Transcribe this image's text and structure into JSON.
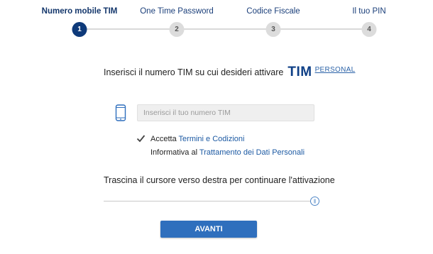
{
  "stepper": {
    "steps": [
      {
        "number": "1",
        "label": "Numero mobile TIM",
        "active": true
      },
      {
        "number": "2",
        "label": "One Time Password",
        "active": false
      },
      {
        "number": "3",
        "label": "Codice Fiscale",
        "active": false
      },
      {
        "number": "4",
        "label": "Il tuo PIN",
        "active": false
      }
    ]
  },
  "headline": {
    "text": "Inserisci il numero TIM su cui desideri attivare",
    "logo_word": "TIM",
    "logo_suffix": "PERSONAL"
  },
  "phone_field": {
    "icon": "smartphone-icon",
    "placeholder": "Inserisci il tuo numero TIM",
    "value": ""
  },
  "terms": {
    "checked": true,
    "accept_prefix": "Accetta",
    "accept_link": "Termini e Codizioni",
    "privacy_prefix": "Informativa al",
    "privacy_link": "Trattamento dei Dati Personali"
  },
  "slider": {
    "instruction": "Trascina il cursore verso destra per continuare l'attivazione",
    "handle_glyph": "|||",
    "value_fraction": 1.0
  },
  "actions": {
    "avanti_label": "AVANTI"
  },
  "colors": {
    "brand_dark": "#0e3a7a",
    "link": "#1d5aa3",
    "button": "#2f6fbd",
    "inactive_step": "#dcdcdc"
  }
}
